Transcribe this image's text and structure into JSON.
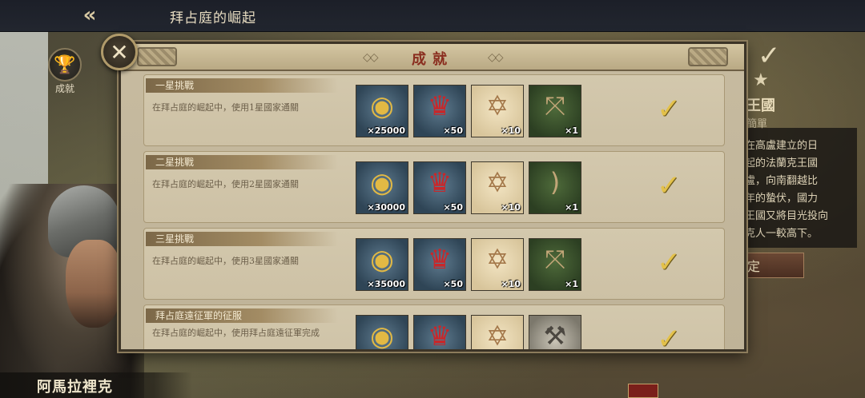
{
  "topbar": {
    "title": "拜占庭的崛起"
  },
  "side": {
    "achievements_label": "成就"
  },
  "character": {
    "name": "阿馬拉裡克"
  },
  "right_panel": {
    "heading": "王國",
    "sub": "簡單",
    "desc": [
      "在高盧建立的日",
      "起的法蘭克王國",
      "盧，向南翻越比",
      "年的蟄伏，國力",
      "王國又將目光投向",
      "克人一較高下。"
    ],
    "button": "定"
  },
  "modal": {
    "title": "成就",
    "rows": [
      {
        "tag": "一星挑戰",
        "desc": "在拜占庭的崛起中，使用1星國家通關",
        "rewards": [
          {
            "icon": "gold-coins-icon",
            "qty": "×25000"
          },
          {
            "icon": "medal-icon",
            "qty": "×50"
          },
          {
            "icon": "scroll-icon",
            "qty": "×10"
          },
          {
            "icon": "crossbow-icon",
            "qty": "×1"
          }
        ]
      },
      {
        "tag": "二星挑戰",
        "desc": "在拜占庭的崛起中，使用2星國家通關",
        "rewards": [
          {
            "icon": "gold-coins-icon",
            "qty": "×30000"
          },
          {
            "icon": "medal-icon",
            "qty": "×50"
          },
          {
            "icon": "scroll-icon",
            "qty": "×10"
          },
          {
            "icon": "bow-icon",
            "qty": "×1"
          }
        ]
      },
      {
        "tag": "三星挑戰",
        "desc": "在拜占庭的崛起中，使用3星國家通關",
        "rewards": [
          {
            "icon": "gold-coins-icon",
            "qty": "×35000"
          },
          {
            "icon": "medal-icon",
            "qty": "×50"
          },
          {
            "icon": "scroll-icon",
            "qty": "×10"
          },
          {
            "icon": "crossbow-icon",
            "qty": "×1"
          }
        ]
      },
      {
        "tag": "拜占庭遠征軍的征服",
        "desc": "在拜占庭的崛起中，使用拜占庭遠征軍完成",
        "rewards": [
          {
            "icon": "gold-coins-icon",
            "qty": ""
          },
          {
            "icon": "medal-icon",
            "qty": ""
          },
          {
            "icon": "scroll-icon",
            "qty": ""
          },
          {
            "icon": "hammer-icon",
            "qty": ""
          }
        ]
      }
    ]
  },
  "colors": {
    "title_red": "#8a2e1f",
    "check_gold": "#e3c14a",
    "parchment": "#c7bba0"
  }
}
